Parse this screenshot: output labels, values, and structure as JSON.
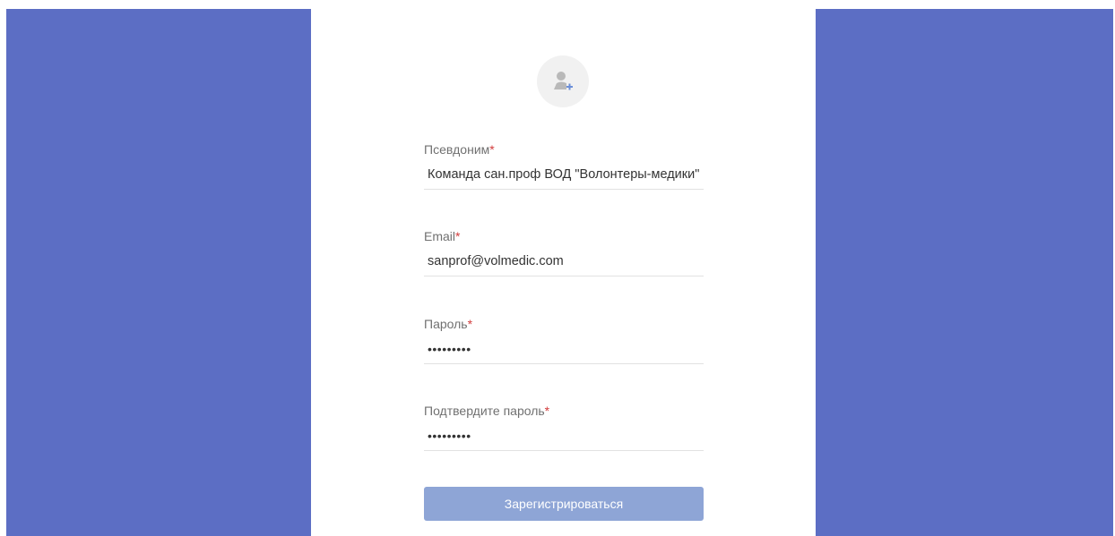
{
  "colors": {
    "side_panel": "#5c6ec4",
    "button_bg": "#8ea5d6",
    "required_marker": "#d23c3c",
    "avatar_bg": "#f1f1f1",
    "avatar_plus": "#6c8fd8"
  },
  "avatar": {
    "icon": "add-user-icon"
  },
  "form": {
    "required_mark": "*",
    "nickname": {
      "label": "Псевдоним",
      "value": "Команда сан.проф ВОД \"Волонтеры-медики\""
    },
    "email": {
      "label": "Email",
      "value": "sanprof@volmedic.com"
    },
    "password": {
      "label": "Пароль",
      "value": "•••••••••"
    },
    "confirm_password": {
      "label": "Подтвердите пароль",
      "value": "•••••••••"
    },
    "submit_label": "Зарегистрироваться"
  }
}
